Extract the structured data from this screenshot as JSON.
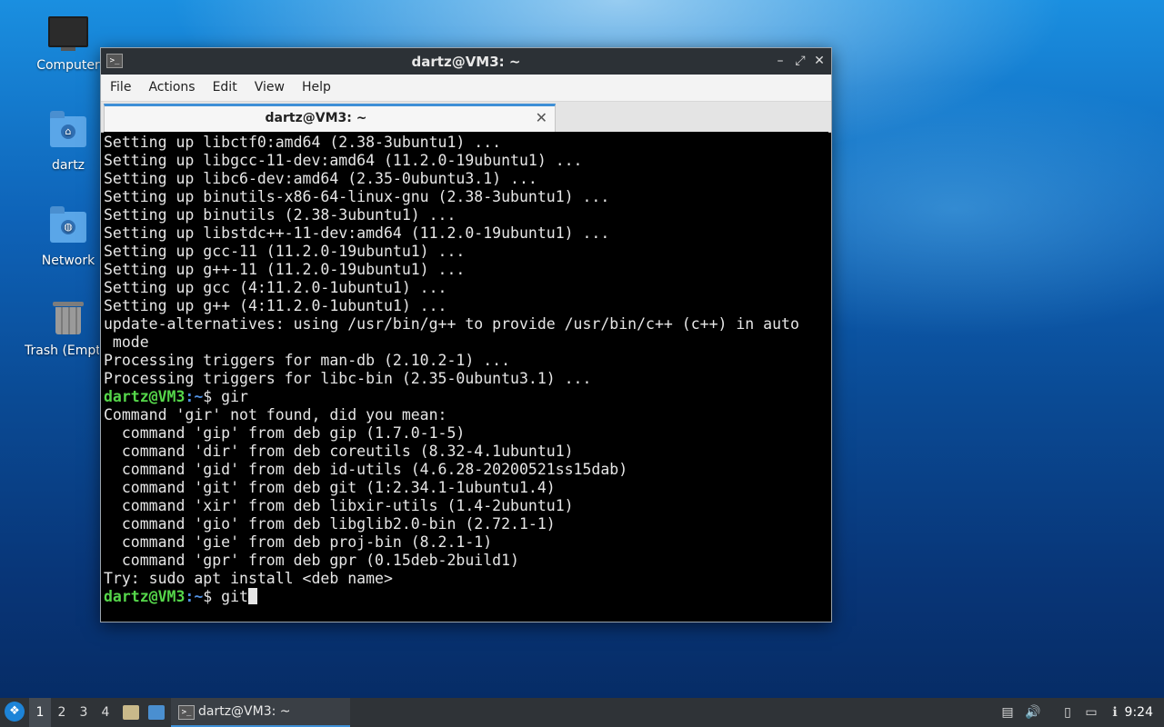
{
  "desktop": {
    "icons": [
      {
        "label": "Computer",
        "icon": "computer-icon"
      },
      {
        "label": "dartz",
        "icon": "home-folder-icon"
      },
      {
        "label": "Network",
        "icon": "network-folder-icon"
      },
      {
        "label": "Trash (Empty)",
        "icon": "trash-icon"
      }
    ]
  },
  "window": {
    "title": "dartz@VM3: ~",
    "controls": {
      "minimize": "–",
      "maximize": "⤢",
      "close": "✕"
    },
    "menu": [
      "File",
      "Actions",
      "Edit",
      "View",
      "Help"
    ],
    "tab": {
      "label": "dartz@VM3: ~",
      "close": "✕"
    }
  },
  "terminal": {
    "prompt_user": "dartz@VM3",
    "prompt_sep": ":",
    "prompt_path": "~",
    "prompt_symbol": "$ ",
    "output_before": [
      "Setting up libctf0:amd64 (2.38-3ubuntu1) ...",
      "Setting up libgcc-11-dev:amd64 (11.2.0-19ubuntu1) ...",
      "Setting up libc6-dev:amd64 (2.35-0ubuntu3.1) ...",
      "Setting up binutils-x86-64-linux-gnu (2.38-3ubuntu1) ...",
      "Setting up binutils (2.38-3ubuntu1) ...",
      "Setting up libstdc++-11-dev:amd64 (11.2.0-19ubuntu1) ...",
      "Setting up gcc-11 (11.2.0-19ubuntu1) ...",
      "Setting up g++-11 (11.2.0-19ubuntu1) ...",
      "Setting up gcc (4:11.2.0-1ubuntu1) ...",
      "Setting up g++ (4:11.2.0-1ubuntu1) ...",
      "update-alternatives: using /usr/bin/g++ to provide /usr/bin/c++ (c++) in auto",
      " mode",
      "Processing triggers for man-db (2.10.2-1) ...",
      "Processing triggers for libc-bin (2.35-0ubuntu3.1) ..."
    ],
    "command1": "gir",
    "output_after": [
      "Command 'gir' not found, did you mean:",
      "  command 'gip' from deb gip (1.7.0-1-5)",
      "  command 'dir' from deb coreutils (8.32-4.1ubuntu1)",
      "  command 'gid' from deb id-utils (4.6.28-20200521ss15dab)",
      "  command 'git' from deb git (1:2.34.1-1ubuntu1.4)",
      "  command 'xir' from deb libxir-utils (1.4-2ubuntu1)",
      "  command 'gio' from deb libglib2.0-bin (2.72.1-1)",
      "  command 'gie' from deb proj-bin (8.2.1-1)",
      "  command 'gpr' from deb gpr (0.15deb-2build1)",
      "Try: sudo apt install <deb name>"
    ],
    "command2": "git"
  },
  "taskbar": {
    "workspaces": [
      "1",
      "2",
      "3",
      "4"
    ],
    "active_workspace": "1",
    "task_label": "dartz@VM3: ~",
    "clock": "9:24"
  },
  "colors": {
    "prompt_user": "#55d64a",
    "prompt_path": "#4f8fe0",
    "accent": "#3d8fd6"
  }
}
